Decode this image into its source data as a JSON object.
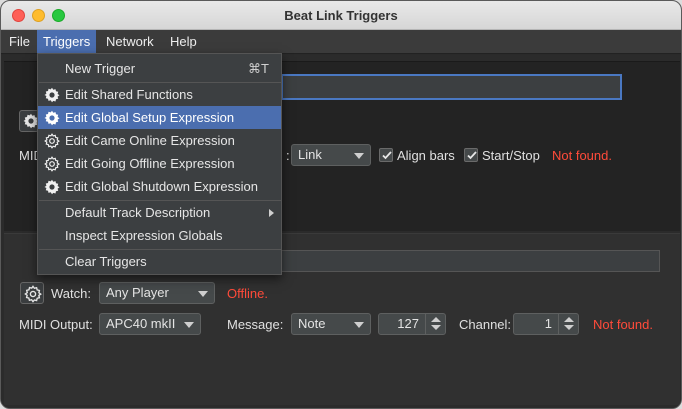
{
  "window": {
    "title": "Beat Link Triggers"
  },
  "menubar": {
    "items": [
      {
        "label": "File"
      },
      {
        "label": "Triggers"
      },
      {
        "label": "Network"
      },
      {
        "label": "Help"
      }
    ]
  },
  "triggers_menu": {
    "new_trigger": {
      "label": "New Trigger",
      "shortcut": "⌘T"
    },
    "edit_shared_functions": "Edit Shared Functions",
    "edit_global_setup": "Edit Global Setup Expression",
    "edit_came_online": "Edit Came Online Expression",
    "edit_going_offline": "Edit Going Offline Expression",
    "edit_global_shutdown": "Edit Global Shutdown Expression",
    "default_track_description": "Default Track Description",
    "inspect_expression_globals": "Inspect Expression Globals",
    "clear_triggers": "Clear Triggers"
  },
  "trigger1": {
    "midi_label_partial": "MIDI",
    "sync_mode": "Link",
    "align_bars": {
      "label": "Align bars",
      "checked": true
    },
    "start_stop": {
      "label": "Start/Stop",
      "checked": true
    },
    "status": "Not found."
  },
  "trigger2": {
    "watch_label": "Watch:",
    "watch_value": "Any Player",
    "watch_status": "Offline.",
    "midi_output_label": "MIDI Output:",
    "midi_output_value": "APC40 mkII",
    "message_label": "Message:",
    "message_value": "Note",
    "note_value": "127",
    "channel_label": "Channel:",
    "channel_value": "1",
    "status": "Not found."
  },
  "colors": {
    "accent": "#4b6eaf",
    "status_error": "#ff4b3a",
    "background": "#2b2b2b"
  },
  "icons": {
    "gear_filled": "gear-icon",
    "gear_outline": "gear-outline-icon"
  }
}
